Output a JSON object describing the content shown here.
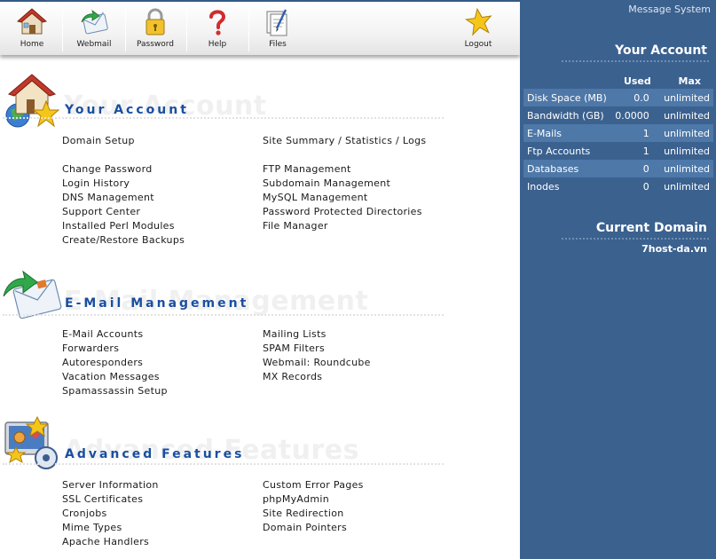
{
  "toolbar": {
    "items": [
      {
        "label": "Home",
        "icon": "home-icon"
      },
      {
        "label": "Webmail",
        "icon": "mail-icon"
      },
      {
        "label": "Password",
        "icon": "padlock-icon"
      },
      {
        "label": "Help",
        "icon": "question-mark-icon"
      },
      {
        "label": "Files",
        "icon": "files-icon"
      },
      {
        "label": "Logout",
        "icon": "star-icon"
      }
    ]
  },
  "sections": {
    "account": {
      "title": "Your Account",
      "watermark": "Your Account",
      "icon": "house-globe-star-icon",
      "col1": [
        "Domain Setup",
        "Change Password",
        "Login History",
        "DNS Management",
        "Support Center",
        "Installed Perl Modules",
        "Create/Restore Backups"
      ],
      "col2": [
        "Site Summary / Statistics / Logs",
        "FTP Management",
        "Subdomain Management",
        "MySQL Management",
        "Password Protected Directories",
        "File Manager"
      ]
    },
    "email": {
      "title": "E-Mail Management",
      "watermark": "E-Mail Management",
      "icon": "envelope-arrow-icon",
      "col1": [
        "E-Mail Accounts",
        "Forwarders",
        "Autoresponders",
        "Vacation Messages",
        "Spamassassin Setup"
      ],
      "col2": [
        "Mailing Lists",
        "SPAM Filters",
        "Webmail: Roundcube",
        "MX Records"
      ]
    },
    "advanced": {
      "title": "Advanced Features",
      "watermark": "Advanced Features",
      "icon": "control-panel-icon",
      "col1": [
        "Server Information",
        "SSL Certificates",
        "Cronjobs",
        "Mime Types",
        "Apache Handlers"
      ],
      "col2": [
        "Custom Error Pages",
        "phpMyAdmin",
        "Site Redirection",
        "Domain Pointers"
      ]
    }
  },
  "sidebar": {
    "message_system": "Message System",
    "account_heading": "Your Account",
    "columns": {
      "used": "Used",
      "max": "Max"
    },
    "rows": [
      {
        "name": "Disk Space (MB)",
        "used": "0.0",
        "max": "unlimited"
      },
      {
        "name": "Bandwidth (GB)",
        "used": "0.0000",
        "max": "unlimited"
      },
      {
        "name": "E-Mails",
        "used": "1",
        "max": "unlimited"
      },
      {
        "name": "Ftp Accounts",
        "used": "1",
        "max": "unlimited"
      },
      {
        "name": "Databases",
        "used": "0",
        "max": "unlimited"
      },
      {
        "name": "Inodes",
        "used": "0",
        "max": "unlimited"
      }
    ],
    "domain_heading": "Current Domain",
    "domain_name": "7host-da.vn"
  },
  "colors": {
    "sidebar_bg": "#3b618f",
    "sidebar_row_alt": "#4e78a8",
    "section_title": "#1a4fa0",
    "toolbar_border": "#355a86"
  }
}
